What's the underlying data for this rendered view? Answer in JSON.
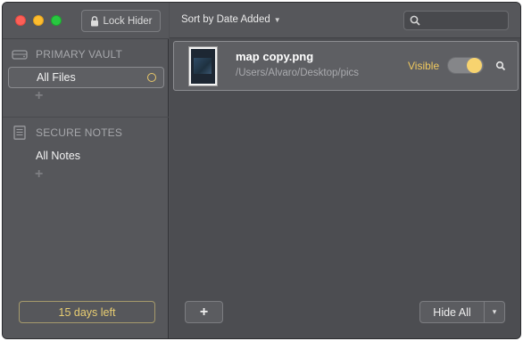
{
  "toolbar": {
    "lock_label": "Lock Hider",
    "sort_label": "Sort by Date Added",
    "search_placeholder": ""
  },
  "sidebar": {
    "vault_header": "PRIMARY VAULT",
    "vault_items": [
      {
        "label": "All Files"
      }
    ],
    "notes_header": "SECURE NOTES",
    "notes_items": [
      {
        "label": "All Notes"
      }
    ],
    "add_symbol": "+",
    "trial_label": "15 days left"
  },
  "files": [
    {
      "name": "map copy.png",
      "path": "/Users/Alvaro/Desktop/pics",
      "status": "Visible",
      "visible": true
    }
  ],
  "footer": {
    "add_symbol": "+",
    "hide_all_label": "Hide All",
    "menu_caret": "▾"
  },
  "colors": {
    "accent": "#f0c95e",
    "background": "#4c4d51",
    "sidebar": "#56575b"
  }
}
